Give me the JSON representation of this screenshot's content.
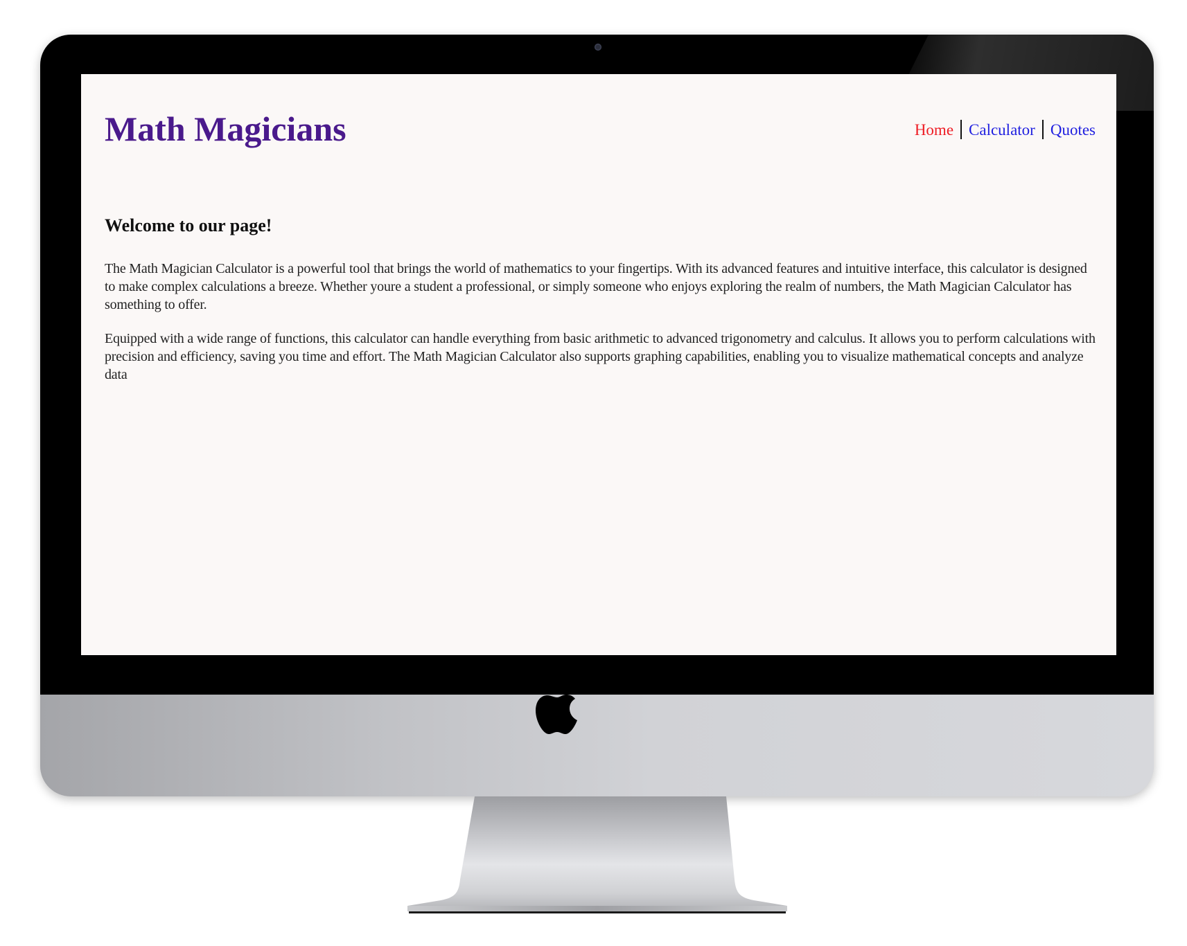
{
  "site": {
    "title": "Math Magicians"
  },
  "nav": {
    "items": [
      {
        "label": "Home",
        "color": "#ee1c24",
        "active": true
      },
      {
        "label": "Calculator",
        "color": "#1f1fe0",
        "active": false
      },
      {
        "label": "Quotes",
        "color": "#1f1fe0",
        "active": false
      }
    ]
  },
  "main": {
    "heading": "Welcome to our page!",
    "paragraphs": [
      "The Math Magician Calculator is a powerful tool that brings the world of mathematics to your fingertips. With its advanced features and intuitive interface, this calculator is designed to make complex calculations a breeze. Whether youre a student a professional, or simply someone who enjoys exploring the realm of numbers, the Math Magician Calculator has something to offer.",
      "Equipped with a wide range of functions, this calculator can handle everything from basic arithmetic to advanced trigonometry and calculus. It allows you to perform calculations with precision and efficiency, saving you time and effort. The Math Magician Calculator also supports graphing capabilities, enabling you to visualize mathematical concepts and analyze data"
    ]
  },
  "device": {
    "logo_icon": "apple-logo-icon"
  }
}
